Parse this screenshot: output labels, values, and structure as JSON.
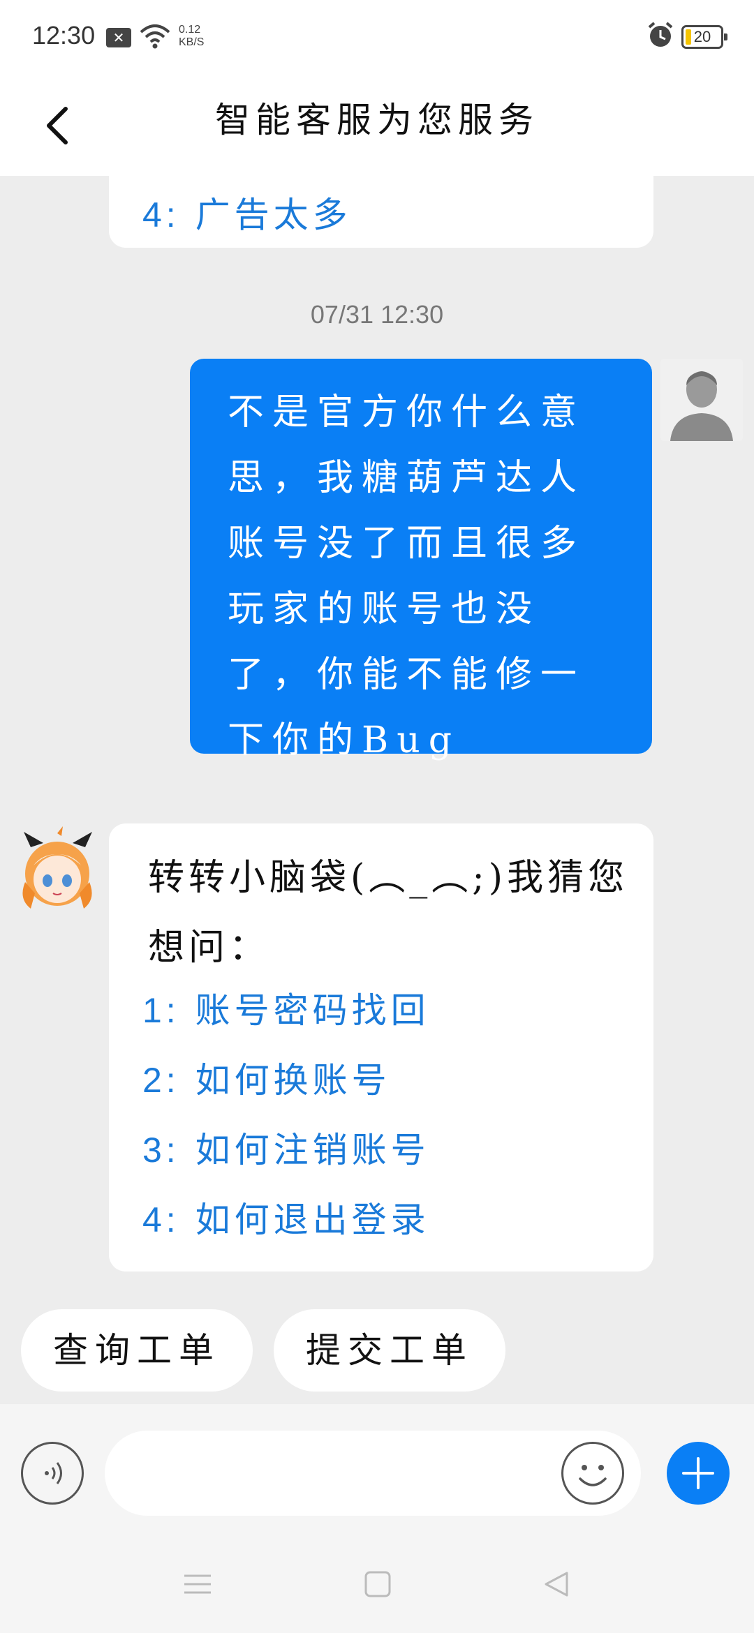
{
  "status_bar": {
    "time": "12:30",
    "speed_value": "0.12",
    "speed_unit": "KB/S",
    "battery": "20"
  },
  "header": {
    "title": "智能客服为您服务"
  },
  "chat": {
    "top_option": {
      "num": "4:",
      "text": "广告太多"
    },
    "timestamp": "07/31 12:30",
    "user_message": "不是官方你什么意思，我糖葫芦达人账号没了而且很多玩家的账号也没了，你能不能修一下你的Bug",
    "bot_message": {
      "intro": "转转小脑袋(︵_︵;)我猜您想问：",
      "options": [
        {
          "num": "1:",
          "text": "账号密码找回"
        },
        {
          "num": "2:",
          "text": "如何换账号"
        },
        {
          "num": "3:",
          "text": "如何注销账号"
        },
        {
          "num": "4:",
          "text": "如何退出登录"
        }
      ]
    }
  },
  "quick_actions": {
    "query": "查询工单",
    "submit": "提交工单"
  },
  "input": {
    "value": "",
    "placeholder": ""
  },
  "colors": {
    "accent": "#0a7ff5",
    "link": "#1a7ad9",
    "background": "#ededed"
  }
}
